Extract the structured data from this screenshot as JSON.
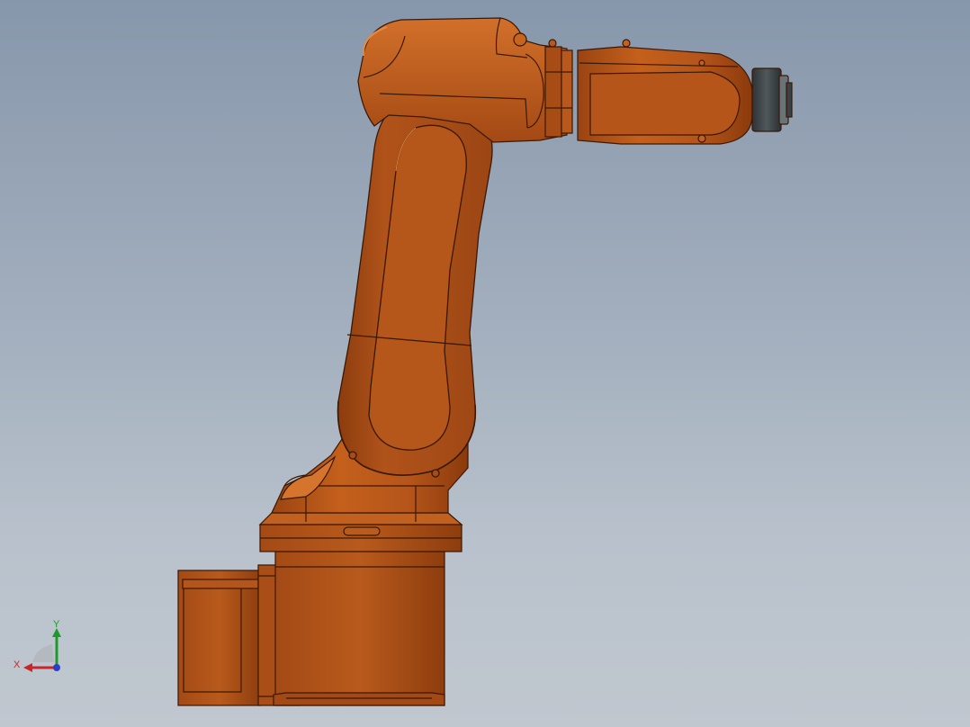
{
  "viewport": {
    "background_top": "#8797ab",
    "background_bottom": "#c0c7cf"
  },
  "model": {
    "description_icon": "industrial-robot-arm",
    "body_color": "#c4601c",
    "shadow_color": "#8a3a0c",
    "highlight_color": "#d9782f",
    "edge_color": "#3a1804",
    "flange_color": "#3c4448"
  },
  "triad": {
    "x_label": "X",
    "y_label": "Y",
    "x_color": "#c8262a",
    "y_color": "#1f9a2a",
    "z_color": "#2a3ec8"
  }
}
